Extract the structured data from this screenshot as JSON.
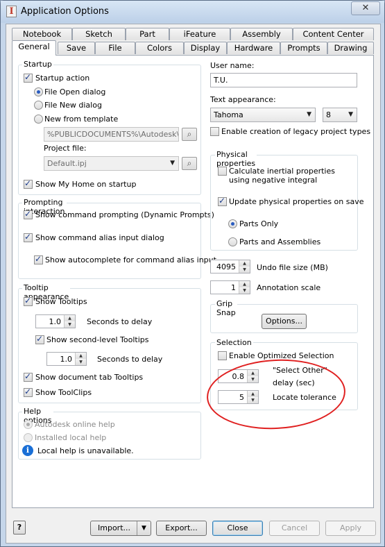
{
  "window": {
    "title": "Application Options",
    "close_glyph": "✕"
  },
  "tabs_row1": [
    "Notebook",
    "Sketch",
    "Part",
    "iFeature",
    "Assembly",
    "Content Center"
  ],
  "tabs_row2": [
    "General",
    "Save",
    "File",
    "Colors",
    "Display",
    "Hardware",
    "Prompts",
    "Drawing"
  ],
  "startup": {
    "group_label": "Startup",
    "startup_action": "Startup action",
    "file_open": "File Open dialog",
    "file_new": "File New dialog",
    "new_from_template": "New from template",
    "template_path": "%PUBLICDOCUMENTS%\\Autodesk\\Inv",
    "project_file_label": "Project file:",
    "project_file": "Default.ipj",
    "show_my_home": "Show My Home on startup"
  },
  "prompting": {
    "group_label": "Prompting interaction",
    "dynamic_prompts": "Show command prompting (Dynamic Prompts)",
    "alias_dialog": "Show command alias input dialog",
    "autocomplete": "Show autocomplete for command alias input"
  },
  "tooltip": {
    "group_label": "Tooltip appearance",
    "show_tooltips": "Show Tooltips",
    "delay1_value": "1.0",
    "delay1_label": "Seconds to delay",
    "second_level": "Show second-level Tooltips",
    "delay2_value": "1.0",
    "delay2_label": "Seconds to delay",
    "doc_tab": "Show document tab Tooltips",
    "toolclips": "Show ToolClips"
  },
  "help": {
    "group_label": "Help options",
    "online": "Autodesk online help",
    "local": "Installed local help",
    "info": "Local help is unavailable.",
    "info_glyph": "i"
  },
  "user": {
    "label": "User name:",
    "value": "T.U."
  },
  "text_appearance": {
    "label": "Text appearance:",
    "font": "Tahoma",
    "size": "8",
    "legacy": "Enable creation of legacy project types"
  },
  "physical": {
    "group_label": "Physical properties",
    "calc_inertial": "Calculate inertial properties using negative integral",
    "update_on_save": "Update physical properties on save",
    "parts_only": "Parts Only",
    "parts_assemblies": "Parts and Assemblies"
  },
  "undo": {
    "value": "4095",
    "label": "Undo file size (MB)"
  },
  "annotation": {
    "value": "1",
    "label": "Annotation scale"
  },
  "grip": {
    "group_label": "Grip Snap",
    "options_button": "Options..."
  },
  "selection": {
    "group_label": "Selection",
    "optimized": "Enable Optimized Selection",
    "select_other_value": "0.8",
    "select_other_label1": "\"Select Other\"",
    "select_other_label2": "delay (sec)",
    "locate_value": "5",
    "locate_label": "Locate tolerance"
  },
  "footer": {
    "help_glyph": "?",
    "import": "Import...",
    "export": "Export...",
    "close": "Close",
    "cancel": "Cancel",
    "apply": "Apply"
  },
  "accent": {
    "annotation_circle": "#e02020",
    "info_icon": "#1a6fd6"
  }
}
